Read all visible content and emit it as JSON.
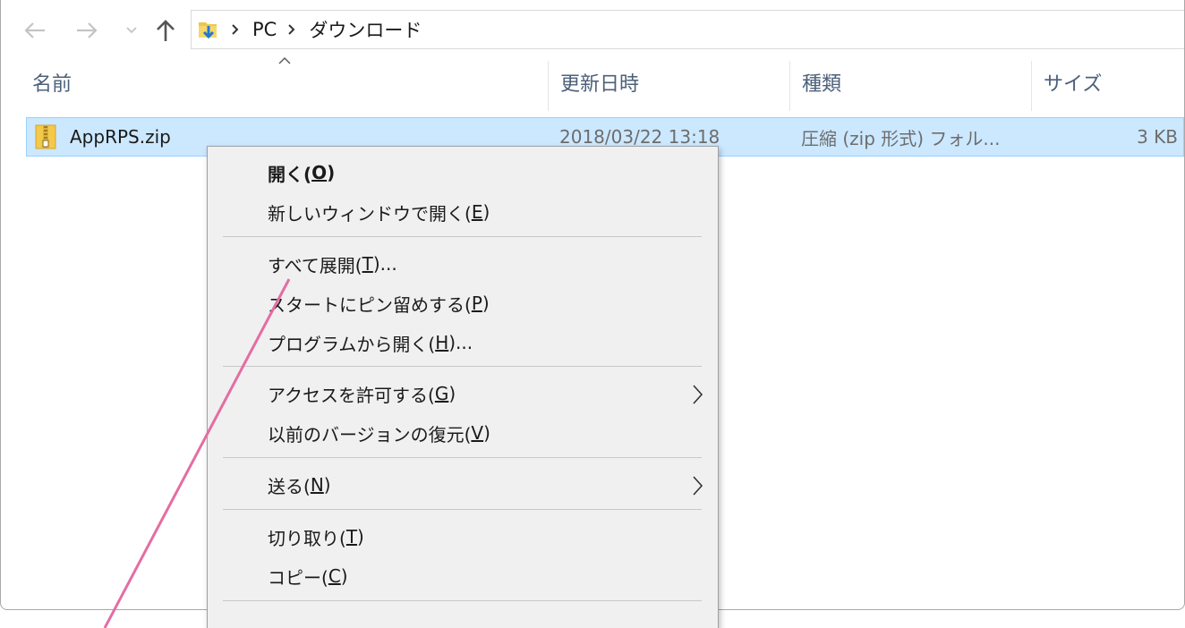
{
  "address_bar": {
    "breadcrumbs": [
      "PC",
      "ダウンロード"
    ]
  },
  "columns": {
    "name": "名前",
    "modified": "更新日時",
    "type": "種類",
    "size": "サイズ"
  },
  "file": {
    "name": "AppRPS.zip",
    "modified": "2018/03/22 13:18",
    "type": "圧縮 (zip 形式) フォル...",
    "size": "3 KB"
  },
  "context_menu": {
    "open": {
      "label": "開く(",
      "accel": "O",
      "tail": ")"
    },
    "open_new_window": {
      "label": "新しいウィンドウで開く(",
      "accel": "E",
      "tail": ")"
    },
    "extract_all": {
      "label": "すべて展開(",
      "accel": "T",
      "tail": ")..."
    },
    "pin_to_start": {
      "label": "スタートにピン留めする(",
      "accel": "P",
      "tail": ")"
    },
    "open_with": {
      "label": "プログラムから開く(",
      "accel": "H",
      "tail": ")..."
    },
    "give_access": {
      "label": "アクセスを許可する(",
      "accel": "G",
      "tail": ")"
    },
    "restore_previous": {
      "label": "以前のバージョンの復元(",
      "accel": "V",
      "tail": ")"
    },
    "send_to": {
      "label": "送る(",
      "accel": "N",
      "tail": ")"
    },
    "cut": {
      "label": "切り取り(",
      "accel": "T",
      "tail": ")"
    },
    "copy": {
      "label": "コピー(",
      "accel": "C",
      "tail": ")"
    }
  },
  "colors": {
    "selection_bg": "#cce8ff",
    "annotation": "#e46da3"
  }
}
